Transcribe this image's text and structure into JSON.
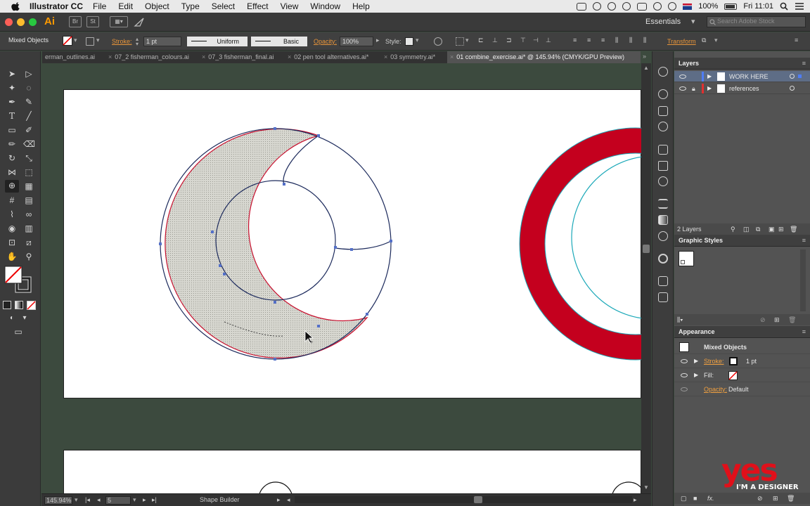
{
  "menubar": {
    "app_name": "Illustrator CC",
    "items": [
      "File",
      "Edit",
      "Object",
      "Type",
      "Select",
      "Effect",
      "View",
      "Window",
      "Help"
    ],
    "battery": "100%",
    "clock": "Fri 11:01"
  },
  "appbar": {
    "logo": "Ai",
    "bridge": "Br",
    "stock": "St",
    "workspace": "Essentials",
    "search_placeholder": "Search Adobe Stock"
  },
  "controlbar": {
    "selection_label": "Mixed Objects",
    "stroke_label": "Stroke:",
    "stroke_value": "1 pt",
    "profile": "Uniform",
    "brush": "Basic",
    "opacity_label": "Opacity:",
    "opacity_value": "100%",
    "style_label": "Style:",
    "transform_label": "Transform"
  },
  "tabs": [
    {
      "label": "erman_outlines.ai",
      "active": false
    },
    {
      "label": "07_2 fisherman_colours.ai",
      "active": false
    },
    {
      "label": "07_3 fisherman_final.ai",
      "active": false
    },
    {
      "label": "02 pen tool alternatives.ai*",
      "active": false
    },
    {
      "label": "03 symmetry.ai*",
      "active": false
    },
    {
      "label": "01 combine_exercise.ai* @ 145.94% (CMYK/GPU Preview)",
      "active": true
    }
  ],
  "statusbar": {
    "zoom": "145.94%",
    "page": "5",
    "tool": "Shape Builder"
  },
  "layers_panel": {
    "title": "Layers",
    "layers": [
      {
        "name": "WORK HERE",
        "color": "#4f7df5",
        "selected": true,
        "locked": false
      },
      {
        "name": "references",
        "color": "#e03030",
        "selected": false,
        "locked": true
      }
    ],
    "count": "2 Layers"
  },
  "graphic_styles_panel": {
    "title": "Graphic Styles"
  },
  "appearance_panel": {
    "title": "Appearance",
    "object": "Mixed Objects",
    "stroke_label": "Stroke:",
    "stroke_value": "1 pt",
    "fill_label": "Fill:",
    "opacity_label": "Opacity:",
    "opacity_value": "Default"
  },
  "watermark": {
    "brand": "yes",
    "tagline": "I'M A DESIGNER"
  },
  "colors": {
    "selection_red": "#c8102e",
    "path_navy": "#1c2a5c",
    "anchor_blue": "#5470c8",
    "shape_fill_red": "#c4001e",
    "reference_cyan": "#1aa8b8",
    "canvas_bg": "#3c4a3e",
    "layer_work_here": "#4f7df5",
    "layer_references": "#e03030"
  }
}
